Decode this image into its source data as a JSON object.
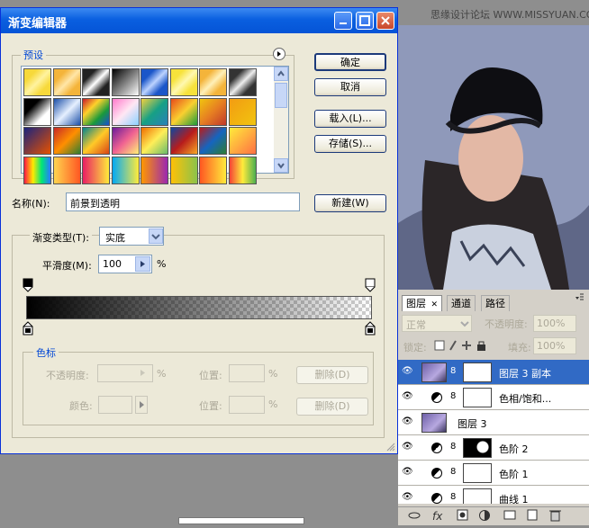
{
  "watermark": "思缘设计论坛 WWW.MISSYUAN.COM",
  "dialog": {
    "title": "渐变编辑器",
    "presets_label": "预设",
    "buttons": {
      "ok": "确定",
      "cancel": "取消",
      "load": "载入(L)...",
      "save": "存储(S)...",
      "new": "新建(W)"
    },
    "name_label": "名称(N):",
    "name_value": "前景到透明",
    "gradient_type_label": "渐变类型(T):",
    "gradient_type_value": "实底",
    "smoothness_label": "平滑度(M):",
    "smoothness_value": "100",
    "smoothness_unit": "%",
    "color_stops": {
      "legend": "色标",
      "opacity_label": "不透明度:",
      "opacity_unit": "%",
      "position_label1": "位置:",
      "position_unit1": "%",
      "delete1": "删除(D)",
      "color_label": "颜色:",
      "position_label2": "位置:",
      "position_unit2": "%",
      "delete2": "删除(D)"
    }
  },
  "layers_panel": {
    "tabs": [
      "图层",
      "通道",
      "路径"
    ],
    "blend_mode": "正常",
    "opacity_label": "不透明度:",
    "opacity_value": "100%",
    "lock_label": "锁定:",
    "fill_label": "填充:",
    "fill_value": "100%",
    "layers": [
      {
        "name": "图层 3 副本",
        "selected": true
      },
      {
        "name": "色相/饱和..."
      },
      {
        "name": "图层 3"
      },
      {
        "name": "色阶 2"
      },
      {
        "name": "色阶 1"
      },
      {
        "name": "曲线 1"
      }
    ]
  }
}
